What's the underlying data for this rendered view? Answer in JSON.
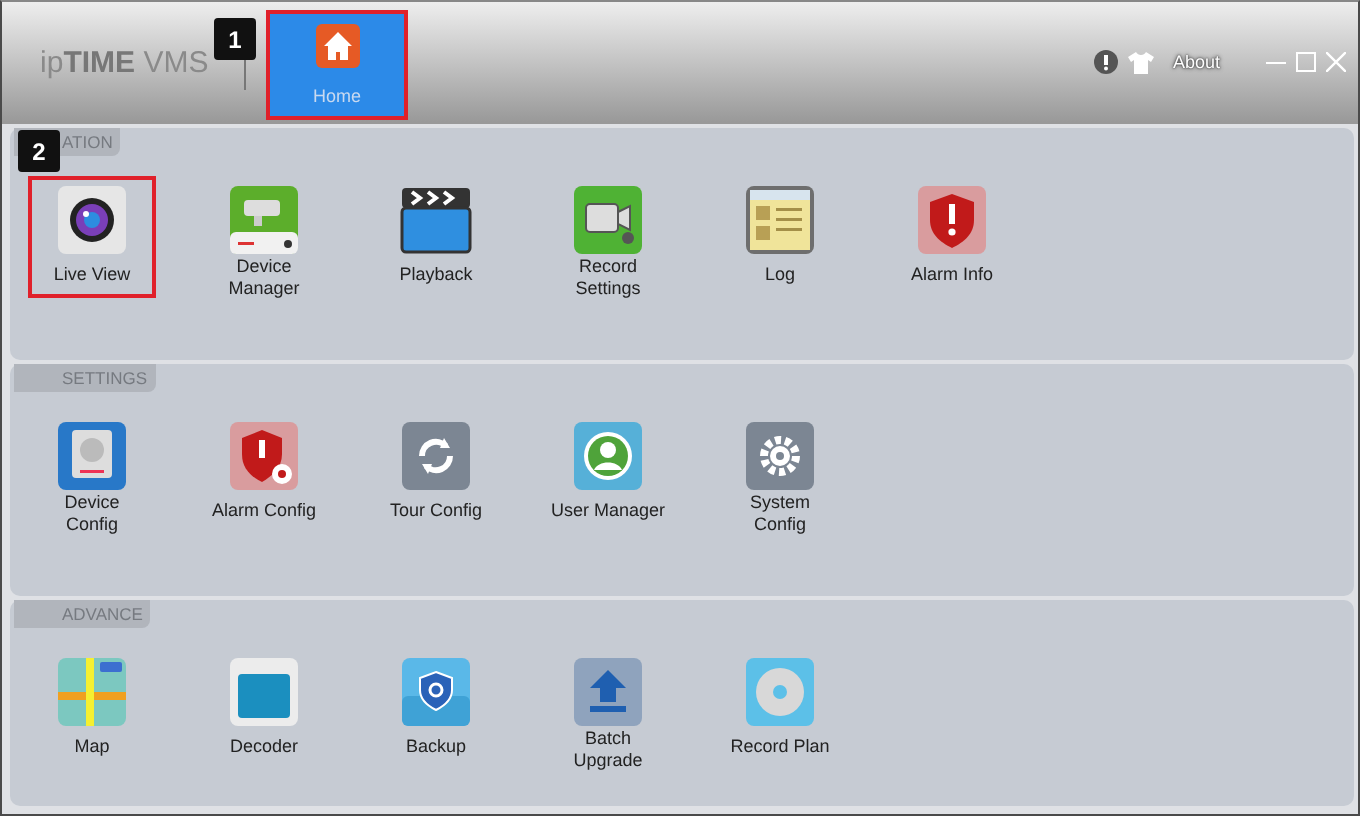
{
  "title_bar": {
    "logo": "ip**TIME** VMS",
    "tabs": [
      {
        "label": "Home",
        "selected": true,
        "highlighted": true
      }
    ],
    "controls": [
      {
        "kind": "alert"
      },
      {
        "kind": "skin"
      },
      {
        "kind": "about",
        "label": "About"
      },
      {
        "kind": "minimize"
      },
      {
        "kind": "maximize"
      },
      {
        "kind": "close"
      }
    ]
  },
  "callouts": [
    {
      "label": "1"
    },
    {
      "label": "2"
    }
  ],
  "sections": [
    {
      "title": "ATION",
      "items": [
        {
          "label": "Live View",
          "highlighted": true
        },
        {
          "label": "Device\nManager",
          "highlighted": false
        },
        {
          "label": "Playback",
          "highlighted": false
        },
        {
          "label": "Record\nSettings",
          "highlighted": false
        },
        {
          "label": "Log",
          "highlighted": false
        },
        {
          "label": "Alarm Info",
          "highlighted": false
        }
      ]
    },
    {
      "title": "SETTINGS",
      "items": [
        {
          "label": "Device\nConfig",
          "highlighted": false
        },
        {
          "label": "Alarm Config",
          "highlighted": false
        },
        {
          "label": "Tour Config",
          "highlighted": false
        },
        {
          "label": "User Manager",
          "highlighted": false
        },
        {
          "label": "System\nConfig",
          "highlighted": false
        }
      ]
    },
    {
      "title": "ADVANCE",
      "items": [
        {
          "label": "Map",
          "highlighted": false
        },
        {
          "label": "Decoder",
          "highlighted": false
        },
        {
          "label": "Backup",
          "highlighted": false
        },
        {
          "label": "Batch\nUpgrade",
          "highlighted": false
        },
        {
          "label": "Record Plan",
          "highlighted": false
        }
      ]
    }
  ]
}
